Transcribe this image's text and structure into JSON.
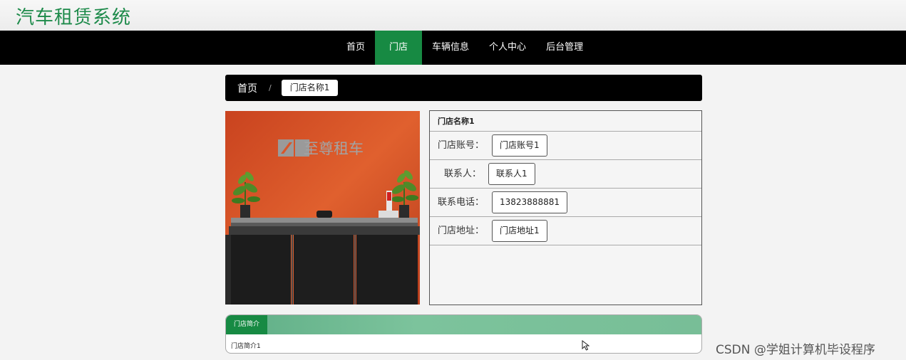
{
  "header": {
    "site_title": "汽车租赁系统"
  },
  "nav": {
    "items": [
      {
        "label": "首页",
        "active": false
      },
      {
        "label": "门店",
        "active": true
      },
      {
        "label": "车辆信息",
        "active": false
      },
      {
        "label": "个人中心",
        "active": false
      },
      {
        "label": "后台管理",
        "active": false
      }
    ]
  },
  "breadcrumb": {
    "home": "首页",
    "separator": "/",
    "current": "门店名称1"
  },
  "store": {
    "image_logo_text": "至尊租车",
    "name": "门店名称1",
    "fields": [
      {
        "label": "门店账号：",
        "value": "门店账号1"
      },
      {
        "label": "联系人：",
        "value": "联系人1"
      },
      {
        "label": "联系电话：",
        "value": "13823888881"
      },
      {
        "label": "门店地址：",
        "value": "门店地址1"
      }
    ]
  },
  "intro": {
    "tab_label": "门店简介",
    "text": "门店简介1"
  },
  "watermark": "CSDN @学姐计算机毕设程序",
  "colors": {
    "accent": "#178a43",
    "nav_bg": "#000000",
    "title_green": "#1d8a4a"
  }
}
